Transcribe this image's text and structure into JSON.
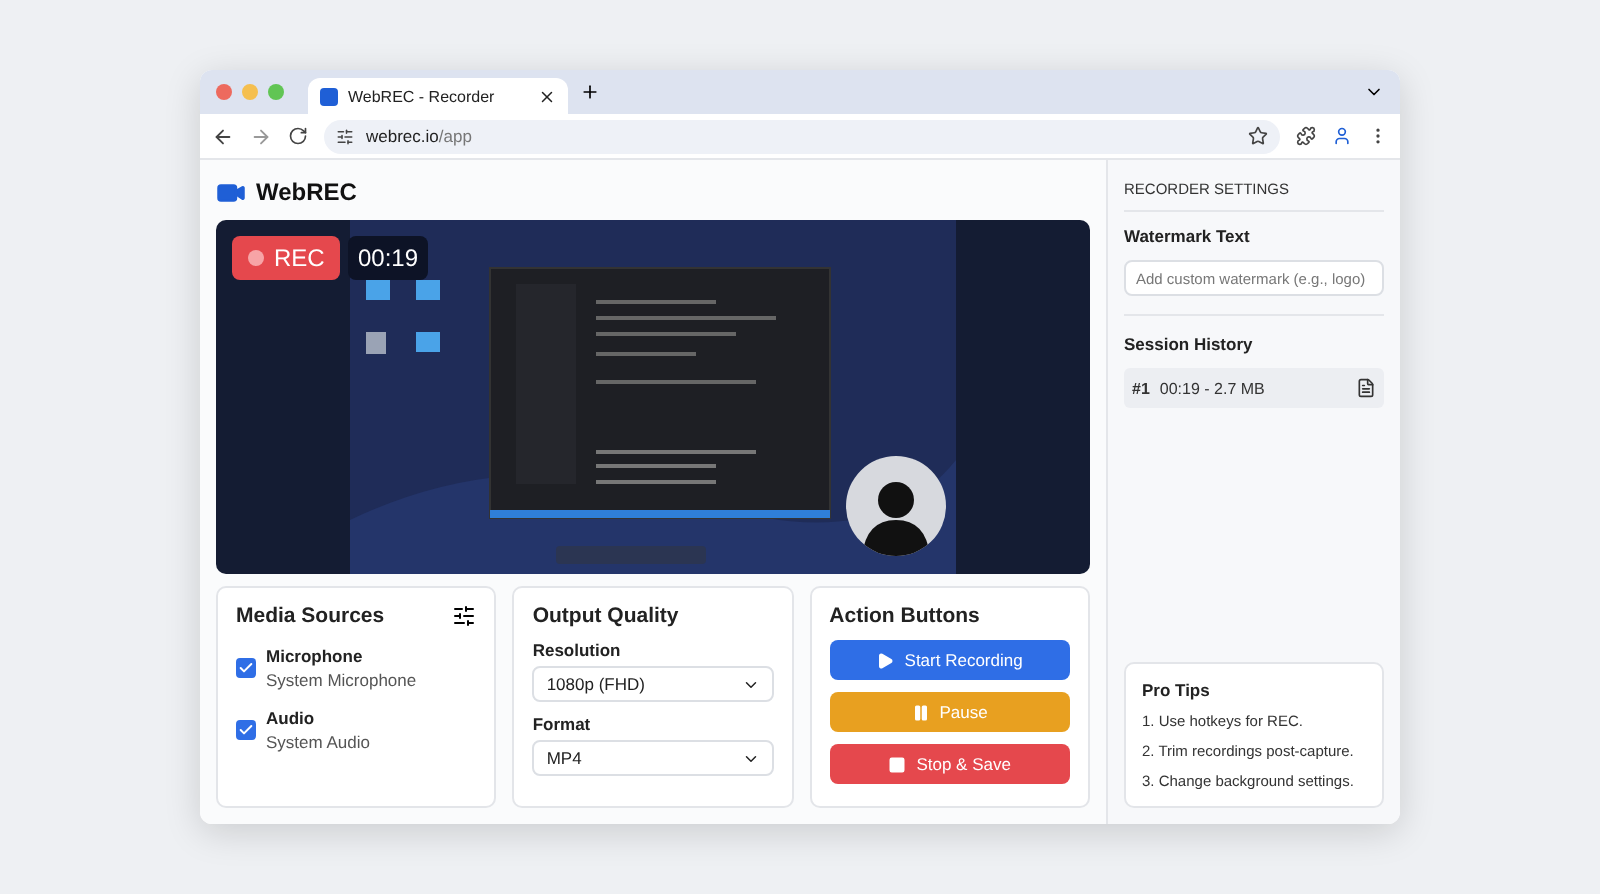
{
  "browser": {
    "tab_title": "WebREC - Recorder",
    "url_host": "webrec.io",
    "url_path": "/app"
  },
  "app": {
    "logo": "WebREC"
  },
  "preview": {
    "rec_label": "REC",
    "timer": "00:19"
  },
  "media_sources": {
    "title": "Media Sources",
    "items": [
      {
        "label": "Microphone",
        "sublabel": "System Microphone",
        "checked": true
      },
      {
        "label": "Audio",
        "sublabel": "System Audio",
        "checked": true
      }
    ]
  },
  "output_quality": {
    "title": "Output Quality",
    "fields": [
      {
        "label": "Resolution",
        "value": "1080p (FHD)"
      },
      {
        "label": "Format",
        "value": "MP4"
      }
    ]
  },
  "actions": {
    "title": "Action Buttons",
    "buttons": [
      {
        "kind": "start",
        "label": "Start Recording"
      },
      {
        "kind": "pause",
        "label": "Pause"
      },
      {
        "kind": "stop",
        "label": "Stop & Save"
      }
    ]
  },
  "sidebar": {
    "heading": "RECORDER SETTINGS",
    "watermark": {
      "label": "Watermark Text",
      "placeholder": "Add custom watermark (e.g., logo)"
    },
    "history": {
      "title": "Session History",
      "items": [
        {
          "index": "#1",
          "detail": "00:19 - 2.7 MB"
        }
      ]
    },
    "tips": {
      "title": "Pro Tips",
      "items": [
        "1. Use hotkeys for REC.",
        "2. Trim recordings post-capture.",
        "3. Change background settings."
      ]
    }
  }
}
